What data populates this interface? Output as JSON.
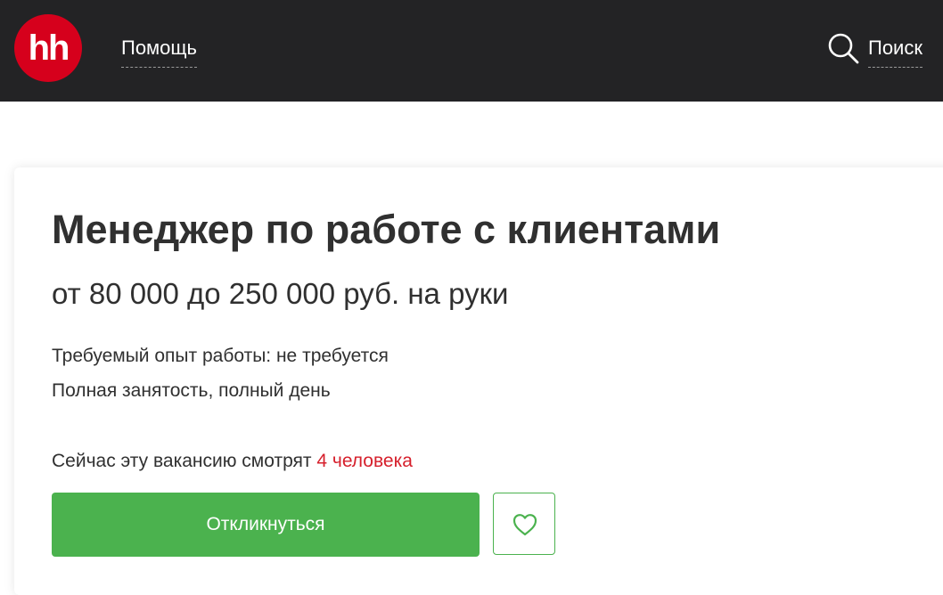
{
  "header": {
    "logo_text": "hh",
    "help_label": "Помощь",
    "search_label": "Поиск",
    "search_icon": "search-icon"
  },
  "vacancy": {
    "title": "Менеджер по работе с клиентами",
    "salary": "от 80 000 до 250 000 руб. на руки",
    "experience": "Требуемый опыт работы: не требуется",
    "employment": "Полная занятость, полный день",
    "viewers_prefix": "Сейчас эту вакансию смотрят ",
    "viewers_count": "4 человека",
    "apply_label": "Откликнуться",
    "favorite_icon": "heart-icon"
  },
  "colors": {
    "header_bg": "#232325",
    "brand_red": "#d6001c",
    "apply_green": "#4bb24e",
    "viewers_red": "#d6202c"
  }
}
